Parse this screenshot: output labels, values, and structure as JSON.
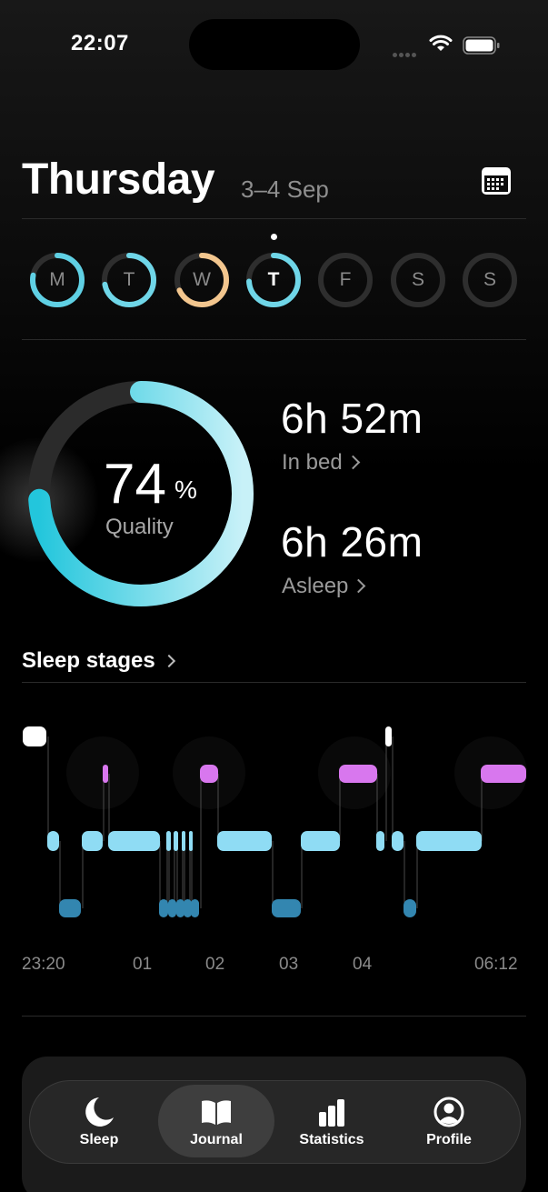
{
  "status_bar": {
    "time": "22:07"
  },
  "header": {
    "day": "Thursday",
    "date_range": "3–4 Sep"
  },
  "week": [
    {
      "letter": "M",
      "progress": 0.78,
      "color": "#5fd0e4",
      "selected": false
    },
    {
      "letter": "T",
      "progress": 0.72,
      "color": "#6fd6e8",
      "selected": false
    },
    {
      "letter": "W",
      "progress": 0.68,
      "color": "#f3c68e",
      "selected": false
    },
    {
      "letter": "T",
      "progress": 0.74,
      "color": "#6fd6e8",
      "selected": true
    },
    {
      "letter": "F",
      "progress": 0,
      "color": "#333333",
      "selected": false
    },
    {
      "letter": "S",
      "progress": 0,
      "color": "#333333",
      "selected": false
    },
    {
      "letter": "S",
      "progress": 0,
      "color": "#333333",
      "selected": false
    }
  ],
  "quality": {
    "value": "74",
    "unit": "%",
    "label": "Quality",
    "progress": 0.74
  },
  "in_bed": {
    "value": "6h 52m",
    "label": "In bed"
  },
  "asleep": {
    "value": "6h 26m",
    "label": "Asleep"
  },
  "sleep_stages": {
    "title": "Sleep stages",
    "time_labels": [
      "23:20",
      "01",
      "02",
      "03",
      "04",
      "06:12"
    ],
    "colors": {
      "awake": "#ffffff",
      "rem": "#d877ee",
      "core": "#8fdcf4",
      "deep": "#3386b0"
    }
  },
  "tab_bar": {
    "tabs": [
      {
        "label": "Sleep",
        "icon": "moon-icon"
      },
      {
        "label": "Journal",
        "icon": "book-icon"
      },
      {
        "label": "Statistics",
        "icon": "bar-chart-icon"
      },
      {
        "label": "Profile",
        "icon": "profile-icon"
      }
    ],
    "active": "Journal"
  }
}
